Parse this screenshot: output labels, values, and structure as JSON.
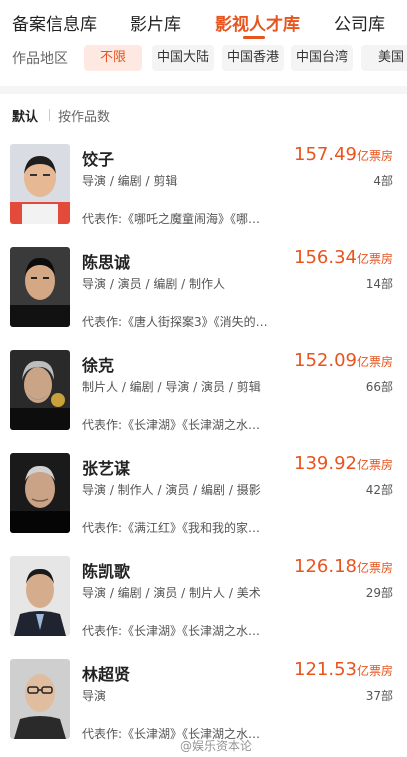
{
  "top_tabs": [
    {
      "label": "备案信息库",
      "active": false
    },
    {
      "label": "影片库",
      "active": false
    },
    {
      "label": "影视人才库",
      "active": true
    },
    {
      "label": "公司库",
      "active": false
    }
  ],
  "region": {
    "label": "作品地区",
    "chips": [
      {
        "label": "不限",
        "active": true
      },
      {
        "label": "中国大陆",
        "active": false
      },
      {
        "label": "中国香港",
        "active": false
      },
      {
        "label": "中国台湾",
        "active": false
      },
      {
        "label": "美国",
        "active": false
      }
    ]
  },
  "sort": {
    "default_label": "默认",
    "by_works_label": "按作品数"
  },
  "box_unit": "亿票房",
  "people": [
    {
      "name": "饺子",
      "roles": "导演 / 编剧 / 剪辑",
      "box": "157.49",
      "count": "4部",
      "works": "代表作:《哪吒之魔童闹海》《哪吒…"
    },
    {
      "name": "陈思诚",
      "roles": "导演 / 演员 / 编剧 / 制作人",
      "box": "156.34",
      "count": "14部",
      "works": "代表作:《唐人街探案3》《消失的…"
    },
    {
      "name": "徐克",
      "roles": "制片人 / 编剧 / 导演 / 演员 / 剪辑",
      "box": "152.09",
      "count": "66部",
      "works": "代表作:《长津湖》《长津湖之水门…"
    },
    {
      "name": "张艺谋",
      "roles": "导演 / 制作人 / 演员 / 编剧 / 摄影",
      "box": "139.92",
      "count": "42部",
      "works": "代表作:《满江红》《我和我的家乡…"
    },
    {
      "name": "陈凯歌",
      "roles": "导演 / 编剧 / 演员 / 制片人 / 美术",
      "box": "126.18",
      "count": "29部",
      "works": "代表作:《长津湖》《长津湖之水门…"
    },
    {
      "name": "林超贤",
      "roles": "导演",
      "box": "121.53",
      "count": "37部",
      "works": "代表作:《长津湖》《长津湖之水门…"
    }
  ],
  "watermark": "@娱乐资本论",
  "colors": {
    "accent": "#e8541e",
    "chip_active_bg": "#fde9e2"
  }
}
